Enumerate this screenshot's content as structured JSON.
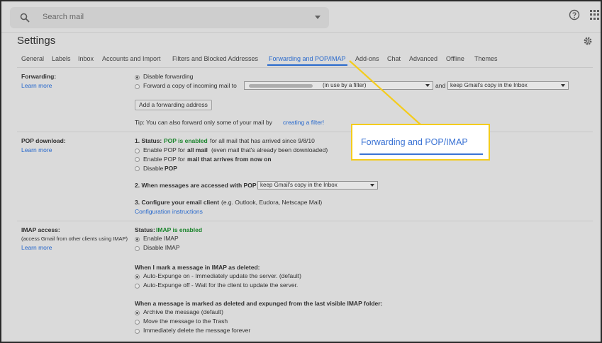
{
  "search": {
    "placeholder": "Search mail"
  },
  "page_title": "Settings",
  "tabs": [
    {
      "label": "General"
    },
    {
      "label": "Labels"
    },
    {
      "label": "Inbox"
    },
    {
      "label": "Accounts and Import"
    },
    {
      "label": "Filters and Blocked Addresses"
    },
    {
      "label": "Forwarding and POP/IMAP"
    },
    {
      "label": "Add-ons"
    },
    {
      "label": "Chat"
    },
    {
      "label": "Advanced"
    },
    {
      "label": "Offline"
    },
    {
      "label": "Themes"
    }
  ],
  "active_tab": "Forwarding and POP/IMAP",
  "forwarding": {
    "heading": "Forwarding:",
    "learn_more": "Learn more",
    "opt_disable": "Disable forwarding",
    "opt_forward": "Forward a copy of incoming mail to",
    "address_suffix": "(in use by a filter)",
    "and_label": "and",
    "keep_copy": "keep Gmail's copy in the Inbox",
    "add_button": "Add a forwarding address",
    "tip": "Tip: You can also forward only some of your mail by",
    "tip_link": "creating a filter!"
  },
  "pop": {
    "heading": "POP download:",
    "learn_more": "Learn more",
    "status_prefix": "1. Status:",
    "status_value": "POP is enabled",
    "status_suffix": "for all mail that has arrived since 9/8/10",
    "opt1_a": "Enable POP for",
    "opt1_b": "all mail",
    "opt1_c": "(even mail that's already been downloaded)",
    "opt2_a": "Enable POP for",
    "opt2_b": "mail that arrives from now on",
    "opt3": "Disable",
    "opt3_b": "POP",
    "q2": "2. When messages are accessed with POP",
    "q2_select": "keep Gmail's copy in the Inbox",
    "q3": "3. Configure your email client",
    "q3_suffix": "(e.g. Outlook, Eudora, Netscape Mail)",
    "config_link": "Configuration instructions"
  },
  "imap": {
    "heading": "IMAP access:",
    "sub": "(access Gmail from other clients using IMAP)",
    "learn_more": "Learn more",
    "status_prefix": "Status:",
    "status_value": "IMAP is enabled",
    "opt_enable": "Enable IMAP",
    "opt_disable": "Disable IMAP",
    "deleted_heading": "When I mark a message in IMAP as deleted:",
    "del_opt1": "Auto-Expunge on - Immediately update the server. (default)",
    "del_opt2": "Auto-Expunge off - Wait for the client to update the server.",
    "expunged_heading": "When a message is marked as deleted and expunged from the last visible IMAP folder:",
    "exp_opt1": "Archive the message (default)",
    "exp_opt2": "Move the message to the Trash",
    "exp_opt3": "Immediately delete the message forever"
  },
  "callout": {
    "label": "Forwarding and POP/IMAP",
    "border_color": "#f4cc1d",
    "text_color": "#3b73d4"
  },
  "icons": [
    "search-icon",
    "dropdown-arrow-icon",
    "help-icon",
    "apps-grid-icon",
    "gear-icon"
  ]
}
